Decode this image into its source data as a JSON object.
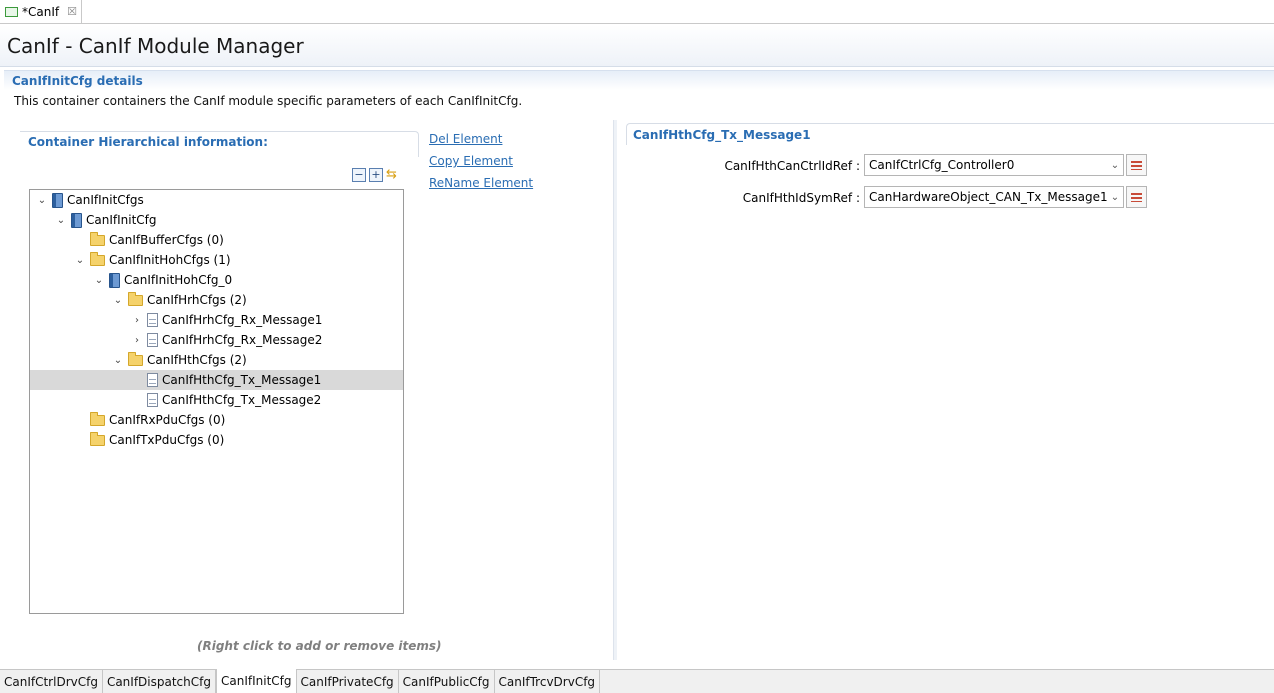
{
  "editor_tab": {
    "label": "*CanIf",
    "close_glyph": "☒"
  },
  "header": {
    "title": "CanIf - CanIf Module Manager"
  },
  "section": {
    "heading": "CanIfInitCfg details",
    "description": "This container containers the CanIf module specific parameters of each CanIfInitCfg."
  },
  "left_panel": {
    "heading": "Container Hierarchical information:",
    "hint": "(Right click to add or remove items)",
    "tools": {
      "collapse": "−",
      "expand": "+",
      "link": "⇆"
    },
    "tree": [
      {
        "label": "CanIfInitCfgs",
        "icon": "book",
        "twisty": "⌄"
      },
      {
        "label": "CanIfInitCfg",
        "icon": "book",
        "twisty": "⌄"
      },
      {
        "label": "CanIfBufferCfgs (0)",
        "icon": "folder",
        "twisty": ""
      },
      {
        "label": "CanIfInitHohCfgs (1)",
        "icon": "folder",
        "twisty": "⌄"
      },
      {
        "label": "CanIfInitHohCfg_0",
        "icon": "book",
        "twisty": "⌄"
      },
      {
        "label": "CanIfHrhCfgs (2)",
        "icon": "folder",
        "twisty": "⌄"
      },
      {
        "label": "CanIfHrhCfg_Rx_Message1",
        "icon": "doc",
        "twisty": "›"
      },
      {
        "label": "CanIfHrhCfg_Rx_Message2",
        "icon": "doc",
        "twisty": "›"
      },
      {
        "label": "CanIfHthCfgs (2)",
        "icon": "folder",
        "twisty": "⌄"
      },
      {
        "label": "CanIfHthCfg_Tx_Message1",
        "icon": "doc",
        "twisty": ""
      },
      {
        "label": "CanIfHthCfg_Tx_Message2",
        "icon": "doc",
        "twisty": ""
      },
      {
        "label": "CanIfRxPduCfgs (0)",
        "icon": "folder",
        "twisty": ""
      },
      {
        "label": "CanIfTxPduCfgs (0)",
        "icon": "folder",
        "twisty": ""
      }
    ],
    "actions": {
      "del": "Del Element",
      "copy": "Copy Element",
      "rename": "ReName Element"
    }
  },
  "right_panel": {
    "heading": "CanIfHthCfg_Tx_Message1",
    "fields": [
      {
        "label": "CanIfHthCanCtrlIdRef :",
        "value": "CanIfCtrlCfg_Controller0"
      },
      {
        "label": "CanIfHthIdSymRef :",
        "value": "CanHardwareObject_CAN_Tx_Message1"
      }
    ]
  },
  "bottom_tabs": [
    "CanIfCtrlDrvCfg",
    "CanIfDispatchCfg",
    "CanIfInitCfg",
    "CanIfPrivateCfg",
    "CanIfPublicCfg",
    "CanIfTrcvDrvCfg"
  ],
  "colors": {
    "accent": "#2a6db3",
    "selection": "#d9d9d9",
    "folder": "#f5d26b"
  }
}
